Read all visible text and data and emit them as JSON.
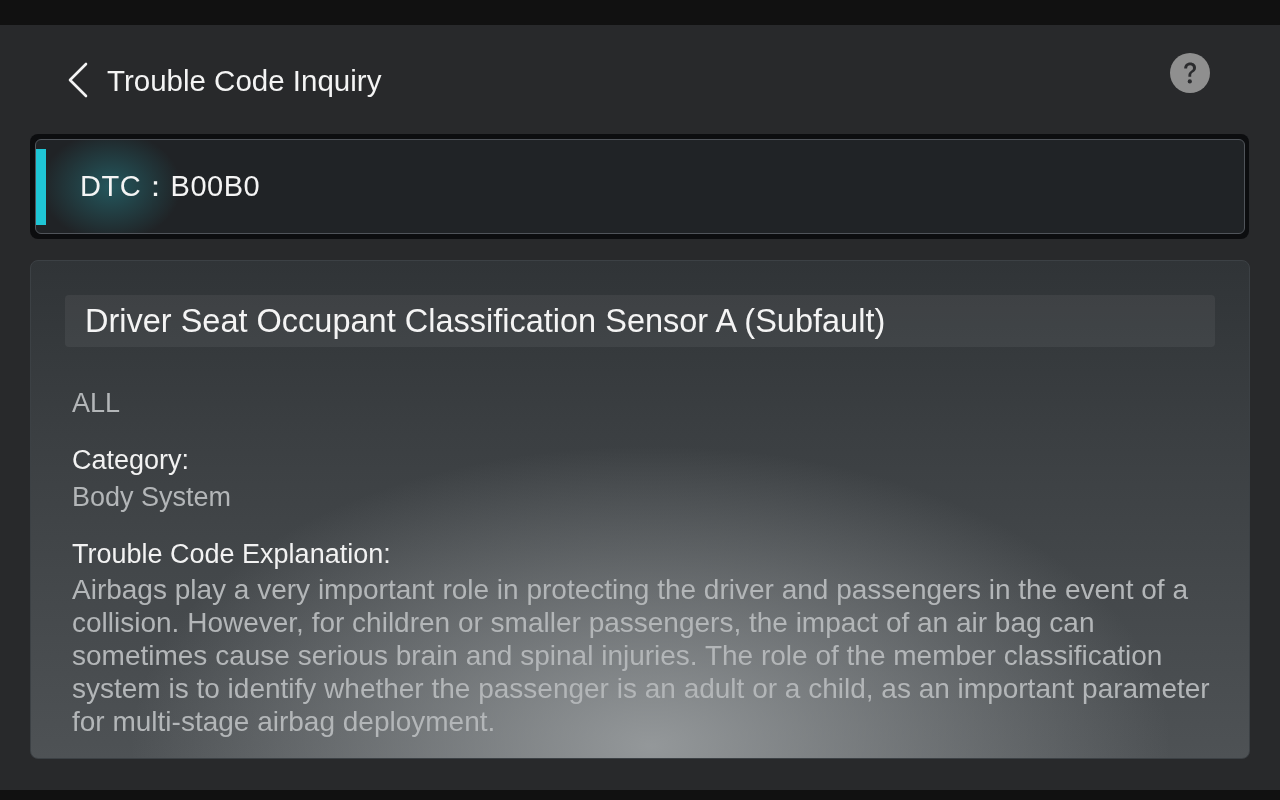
{
  "header": {
    "title": "Trouble Code Inquiry"
  },
  "dtc": {
    "text": "DTC：B00B0"
  },
  "fault": {
    "title": "Driver Seat Occupant Classification Sensor A (Subfault)",
    "details": [
      {
        "kind": "value",
        "value": "ALL"
      },
      {
        "kind": "field",
        "label": "Category:",
        "value": "Body System"
      },
      {
        "kind": "paragraph",
        "label": "Trouble Code Explanation:",
        "value": "Airbags play a very important role in protecting the driver and passengers in the event of a collision. However, for children or smaller passengers, the impact of an air bag can sometimes cause serious brain and spinal injuries. The role of the member classification system is to identify whether the passenger is an adult or a child, as an important parameter for multi-stage airbag deployment."
      }
    ]
  }
}
